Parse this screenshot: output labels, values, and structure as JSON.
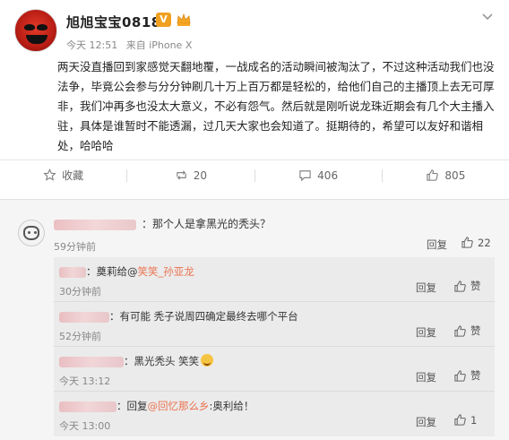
{
  "post": {
    "username": "旭旭宝宝0818",
    "vip_badge": "V",
    "time": "今天 12:51",
    "source": "来自 iPhone X",
    "text": "两天没直播回到家感觉天翻地覆，一战成名的活动瞬间被淘汰了，不过这种活动我们也没法争，毕竟公会参与分分钟刷几十万上百万都是轻松的，给他们自己的主播顶上去无可厚非，我们冲再多也没太大意义，不必有怨气。然后就是刚听说龙珠近期会有几个大主播入驻，具体是谁暂时不能透漏，过几天大家也会知道了。挺期待的，希望可以友好和谐相处，哈哈哈"
  },
  "actions": {
    "collect": "收藏",
    "repost": "20",
    "comment": "406",
    "like": "805"
  },
  "comment": {
    "text": "：那个人是拿黑光的秃头？",
    "time": "59分钟前",
    "reply": "回复",
    "likes": "22"
  },
  "replies": [
    {
      "prefix": "：奠莉给@",
      "mention": "笑笑_孙亚龙",
      "suffix": "",
      "time": "30分钟前",
      "reply": "回复",
      "like": "赞"
    },
    {
      "prefix": "：有可能  秃子说周四确定最终去哪个平台",
      "mention": "",
      "suffix": "",
      "time": "52分钟前",
      "reply": "回复",
      "like": "赞"
    },
    {
      "prefix": "：黑光秃头 笑笑",
      "mention": "",
      "suffix": "",
      "time": "今天 13:12",
      "reply": "回复",
      "like": "赞"
    },
    {
      "prefix": "：回复",
      "mention": "@回忆那么乡",
      "suffix": ":奥利给！",
      "time": "今天 13:00",
      "reply": "回复",
      "like": "1"
    }
  ]
}
